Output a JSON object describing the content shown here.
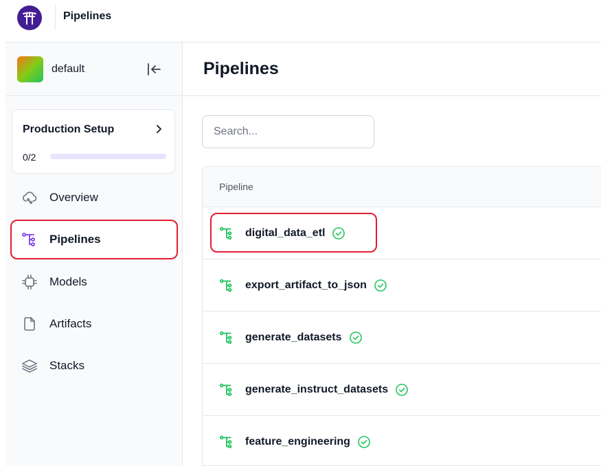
{
  "app": {
    "title": "Pipelines"
  },
  "sidebar": {
    "workspace": "default",
    "setup": {
      "title": "Production Setup",
      "count": "0/2",
      "progress": 0
    },
    "items": [
      {
        "label": "Overview",
        "icon": "cloud-icon"
      },
      {
        "label": "Pipelines",
        "icon": "pipeline-icon",
        "active": true
      },
      {
        "label": "Models",
        "icon": "chip-icon"
      },
      {
        "label": "Artifacts",
        "icon": "file-icon"
      },
      {
        "label": "Stacks",
        "icon": "layers-icon"
      }
    ]
  },
  "main": {
    "title": "Pipelines",
    "search_placeholder": "Search...",
    "table": {
      "header": "Pipeline",
      "rows": [
        {
          "name": "digital_data_etl",
          "status": "success"
        },
        {
          "name": "export_artifact_to_json",
          "status": "success"
        },
        {
          "name": "generate_datasets",
          "status": "success"
        },
        {
          "name": "generate_instruct_datasets",
          "status": "success"
        },
        {
          "name": "feature_engineering",
          "status": "success"
        }
      ]
    }
  },
  "colors": {
    "accent": "#7c3aed",
    "success": "#22c55e",
    "highlight": "#e11d2e",
    "brand": "#431d93"
  }
}
